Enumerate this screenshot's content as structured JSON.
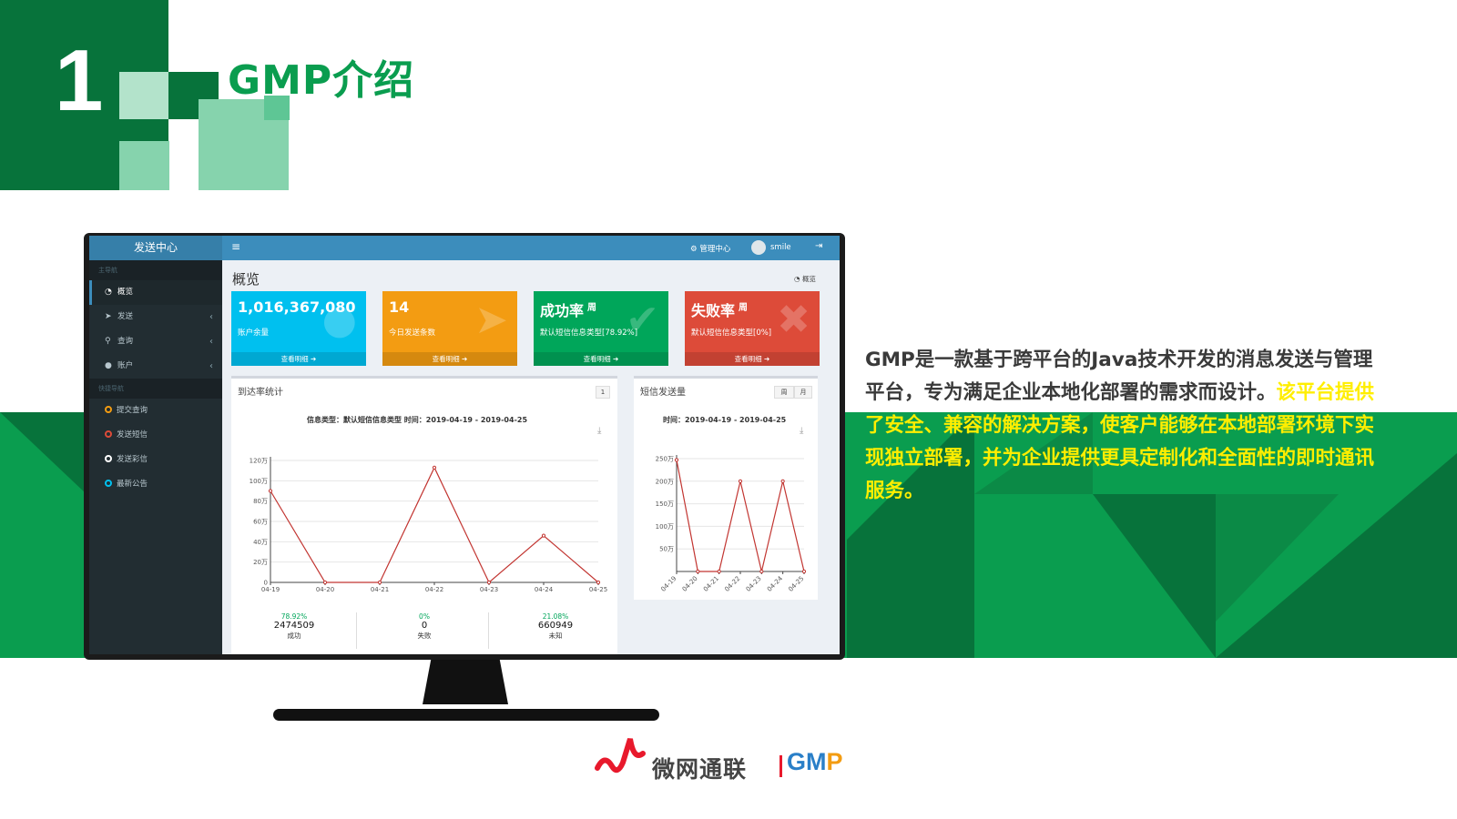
{
  "slide": {
    "number": "1",
    "title": "GMP介绍",
    "description_dark": "GMP是一款基于跨平台的Java技术开发的消息发送与管理平台，专为满足企业本地化部署的需求而设计。",
    "description_highlight": "该平台提供了安全、兼容的解决方案，使客户能够在本地部署环境下实现独立部署，并为企业提供更具定制化和全面性的即时通讯服务。",
    "logo_cn": "微网通联",
    "logo_gmp_a": "GM",
    "logo_gmp_b": "P",
    "colors": {
      "green_dark": "#07733b",
      "green": "#0a9d4f",
      "green_light": "#86d3ad",
      "highlight": "#ffee00"
    }
  },
  "app": {
    "brand": "发送中心",
    "sidebar": {
      "main_header": "主导航",
      "items": [
        {
          "label": "概览",
          "icon": "dashboard-icon"
        },
        {
          "label": "发送",
          "icon": "send-icon"
        },
        {
          "label": "查询",
          "icon": "search-icon"
        },
        {
          "label": "账户",
          "icon": "user-icon"
        }
      ],
      "quick_header": "快捷导航",
      "quick_items": [
        {
          "label": "提交查询",
          "color": "#f39c12"
        },
        {
          "label": "发送短信",
          "color": "#dd4b39"
        },
        {
          "label": "发送彩信",
          "color": "#ffffff"
        },
        {
          "label": "最新公告",
          "color": "#00c0ef"
        }
      ]
    },
    "topbar": {
      "admin_label": "管理中心",
      "username": "smile"
    },
    "page_title": "概览",
    "breadcrumb": "概览",
    "stats": [
      {
        "value": "1,016,367,080",
        "label": "账户余量",
        "footer": "查看明细",
        "sup": "",
        "color": "#00c0ef"
      },
      {
        "value": "14",
        "label": "今日发送条数",
        "footer": "查看明细",
        "sup": "",
        "color": "#f39c12"
      },
      {
        "value": "成功率",
        "sup": "周",
        "label": "默认短信信息类型[78.92%]",
        "footer": "查看明细",
        "color": "#00a65a"
      },
      {
        "value": "失败率",
        "sup": "周",
        "label": "默认短信信息类型[0%]",
        "footer": "查看明细",
        "color": "#dd4b39"
      }
    ],
    "panel_left": {
      "title": "到达率统计",
      "tool": "1",
      "subtitle": "信息类型：默认短信信息类型 时间：2019-04-19 - 2019-04-25",
      "kpis": [
        {
          "percent": "78.92%",
          "value": "2474509",
          "label": "成功"
        },
        {
          "percent": "0%",
          "value": "0",
          "label": "失败"
        },
        {
          "percent": "21.08%",
          "value": "660949",
          "label": "未知"
        }
      ]
    },
    "panel_right": {
      "title": "短信发送量",
      "tools": [
        "周",
        "月"
      ],
      "subtitle": "时间：2019-04-19 - 2019-04-25"
    }
  },
  "chart_data": [
    {
      "type": "line",
      "title": "",
      "x": [
        "04-19",
        "04-20",
        "04-21",
        "04-22",
        "04-23",
        "04-24",
        "04-25"
      ],
      "y_ticks": [
        "0",
        "20万",
        "40万",
        "60万",
        "80万",
        "100万",
        "120万"
      ],
      "ylim": [
        0,
        120
      ],
      "series": [
        {
          "values": [
            90,
            0,
            0,
            113,
            0,
            46,
            0
          ],
          "color": "#c23531"
        }
      ]
    },
    {
      "type": "line",
      "title": "",
      "x": [
        "04-19",
        "04-20",
        "04-21",
        "04-22",
        "04-23",
        "04-24",
        "04-25"
      ],
      "y_ticks": [
        "50万",
        "100万",
        "150万",
        "200万",
        "250万"
      ],
      "ylim": [
        0,
        250
      ],
      "series": [
        {
          "values": [
            247,
            0,
            0,
            200,
            0,
            200,
            0
          ],
          "color": "#c23531"
        }
      ]
    }
  ]
}
